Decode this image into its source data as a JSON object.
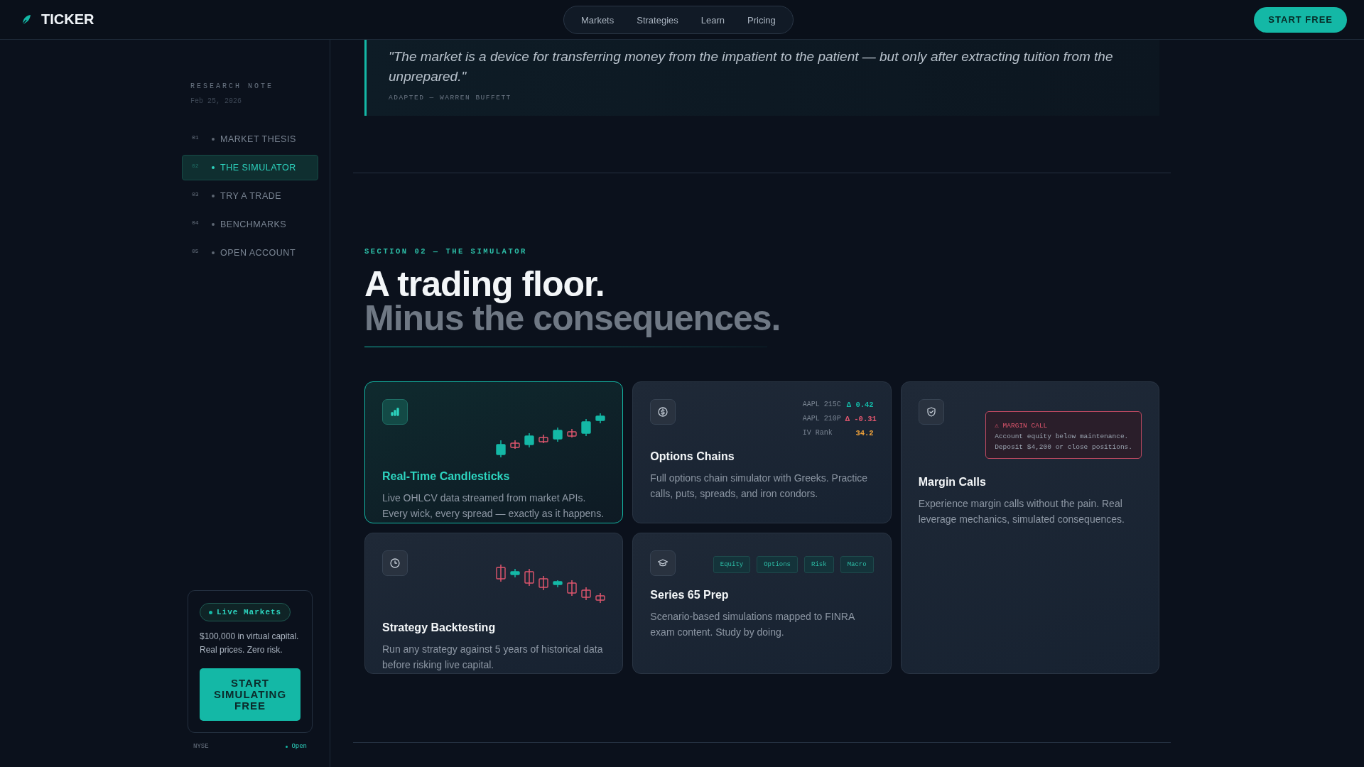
{
  "header": {
    "logo": "TICKER",
    "nav": [
      {
        "label": "Markets"
      },
      {
        "label": "Strategies"
      },
      {
        "label": "Learn"
      },
      {
        "label": "Pricing"
      }
    ],
    "cta": "START FREE"
  },
  "sidebar": {
    "eyebrow": "RESEARCH NOTE",
    "date": "Feb 25, 2026",
    "items": [
      {
        "number": "01",
        "label": "MARKET THESIS",
        "selected": false
      },
      {
        "number": "02",
        "label": "THE SIMULATOR",
        "selected": true
      },
      {
        "number": "03",
        "label": "TRY A TRADE",
        "selected": false
      },
      {
        "number": "04",
        "label": "BENCHMARKS",
        "selected": false
      },
      {
        "number": "05",
        "label": "OPEN ACCOUNT",
        "selected": false
      }
    ],
    "promo": {
      "badge": "Live Markets",
      "text": "$100,000 in virtual capital. Real prices. Zero risk.",
      "button": "START SIMULATING FREE"
    },
    "status": {
      "exchange": "NYSE",
      "state": "Open"
    }
  },
  "quote": {
    "text": "\"The market is a device for transferring money from the impatient to the patient — but only after extracting tuition from the unprepared.\"",
    "attribution": "ADAPTED — WARREN BUFFETT"
  },
  "section": {
    "eyebrow": "SECTION 02 — THE SIMULATOR",
    "title": "A trading floor.",
    "subtitle": "Minus the consequences."
  },
  "cards": [
    {
      "kind": "candles-up",
      "title": "Real-Time Candlesticks",
      "text": "Live OHLCV data streamed from market APIs. Every wick, every spread — exactly as it happens.",
      "highlighted": true
    },
    {
      "kind": "options",
      "title": "Options Chains",
      "text": "Full options chain simulator with Greeks. Practice calls, puts, spreads, and iron condors.",
      "highlighted": false,
      "rows": [
        {
          "label": "AAPL 215C",
          "value": "Δ 0.42",
          "color": "#14b8a6"
        },
        {
          "label": "AAPL 210P",
          "value": "Δ -0.31",
          "color": "#e0566e"
        },
        {
          "label": "IV Rank",
          "value": "34.2",
          "color": "#f0a23a"
        }
      ]
    },
    {
      "kind": "margin",
      "title": "Margin Calls",
      "text": "Experience margin calls without the pain. Real leverage mechanics, simulated consequences.",
      "highlighted": false,
      "alert": {
        "title": "⚠ MARGIN CALL",
        "lines": [
          "Account equity below maintenance.",
          "Deposit $4,200 or close positions."
        ]
      }
    },
    {
      "kind": "candles-down",
      "title": "Strategy Backtesting",
      "text": "Run any strategy against 5 years of historical data before risking live capital.",
      "highlighted": false
    },
    {
      "kind": "tags",
      "title": "Series 65 Prep",
      "text": "Scenario-based simulations mapped to FINRA exam content. Study by doing.",
      "highlighted": false,
      "tags": [
        "Equity",
        "Options",
        "Risk",
        "Macro"
      ]
    }
  ]
}
